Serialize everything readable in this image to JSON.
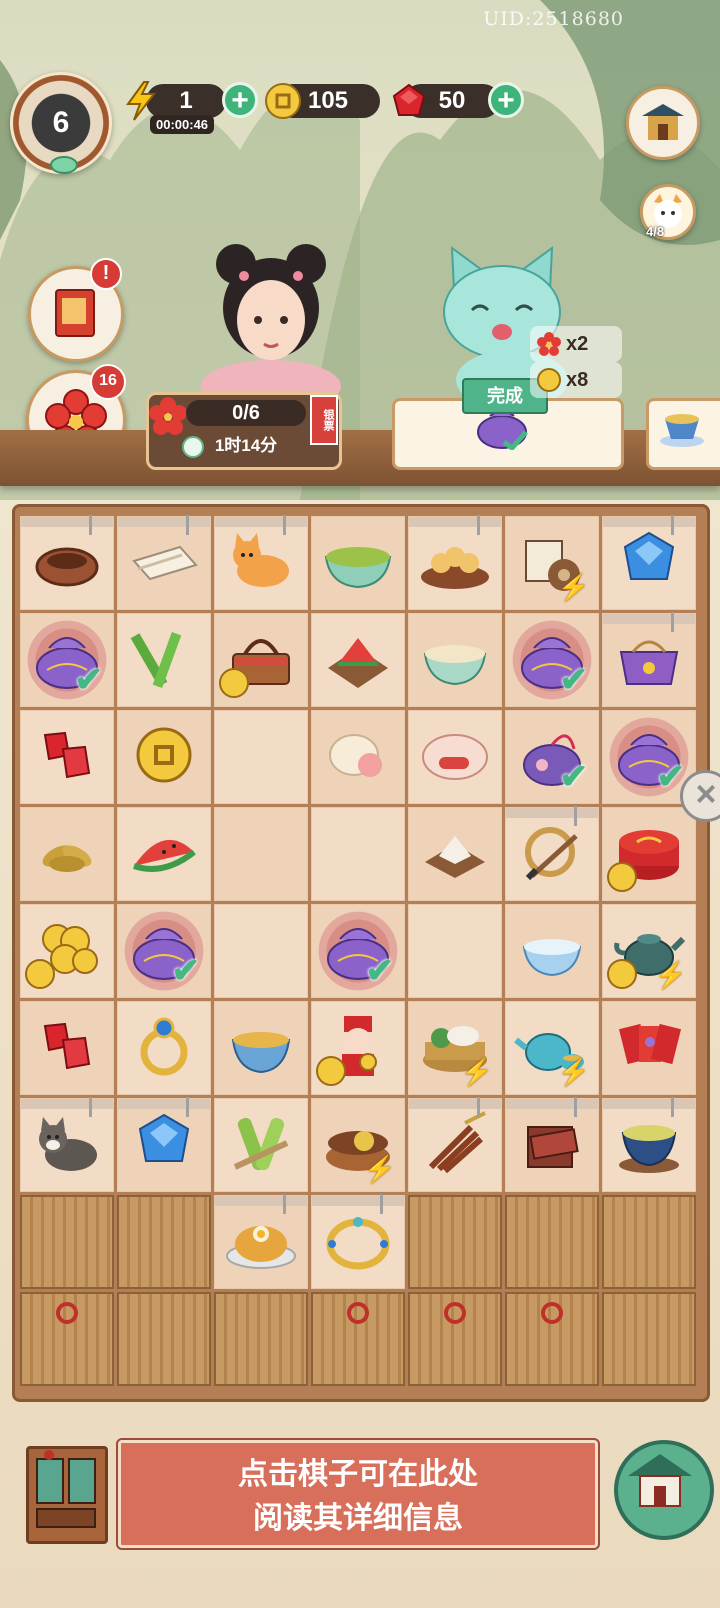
{
  "header": {
    "uid": "UID:2518680",
    "level": "6",
    "energy": {
      "value": "1",
      "timer": "00:00:46"
    },
    "coins": {
      "value": "105"
    },
    "gems": {
      "value": "50"
    }
  },
  "side_buttons": {
    "quest_badge": "!",
    "flower_badge": "16",
    "cat_progress": "4/8"
  },
  "order": {
    "progress": "0/6",
    "time": "1时14分",
    "ticket": "银票"
  },
  "delivery": {
    "done_label": "完成",
    "rewards": [
      {
        "icon": "plum-flower-icon",
        "text": "x2"
      },
      {
        "icon": "coin-icon",
        "text": "x8"
      }
    ]
  },
  "info_panel": {
    "line1": "点击棋子可在此处",
    "line2": "阅读其详细信息"
  },
  "board": {
    "rows": [
      [
        "bird-nest",
        "cloth-bolt",
        "orange-cat",
        "green-bean-soup",
        "chick-nest",
        "scroll-wheel",
        "blue-gem"
      ],
      [
        "purple-pouch",
        "bamboo",
        "picnic-basket",
        "watermelon-tray",
        "rice-porridge",
        "purple-pouch",
        "purple-handbag"
      ],
      [
        "red-gems",
        "gold-coin",
        "",
        "steamed-bun",
        "red-bean-cake",
        "flower-pouch",
        "purple-pouch"
      ],
      [
        "dried-leaves",
        "watermelon-slice",
        "",
        "",
        "sugar-tray",
        "brush-scroll",
        "red-box"
      ],
      [
        "coin-pile",
        "purple-pouch",
        "",
        "purple-pouch",
        "",
        "blue-bowl",
        "teapot"
      ],
      [
        "red-gems",
        "gold-ring",
        "tea-cup",
        "fortune-child",
        "steamer-basket",
        "blue-teapot",
        "red-envelopes"
      ],
      [
        "tabby-cat",
        "blue-gem",
        "bamboo-shoots",
        "yarn-basket",
        "cinnamon-bundle",
        "wood-box",
        "tea-bowl"
      ],
      [
        "locked",
        "locked",
        "fried-rice",
        "gold-bracelet",
        "locked",
        "locked",
        "locked"
      ],
      [
        "locked",
        "locked",
        "locked",
        "locked",
        "locked",
        "locked",
        "locked"
      ]
    ]
  }
}
